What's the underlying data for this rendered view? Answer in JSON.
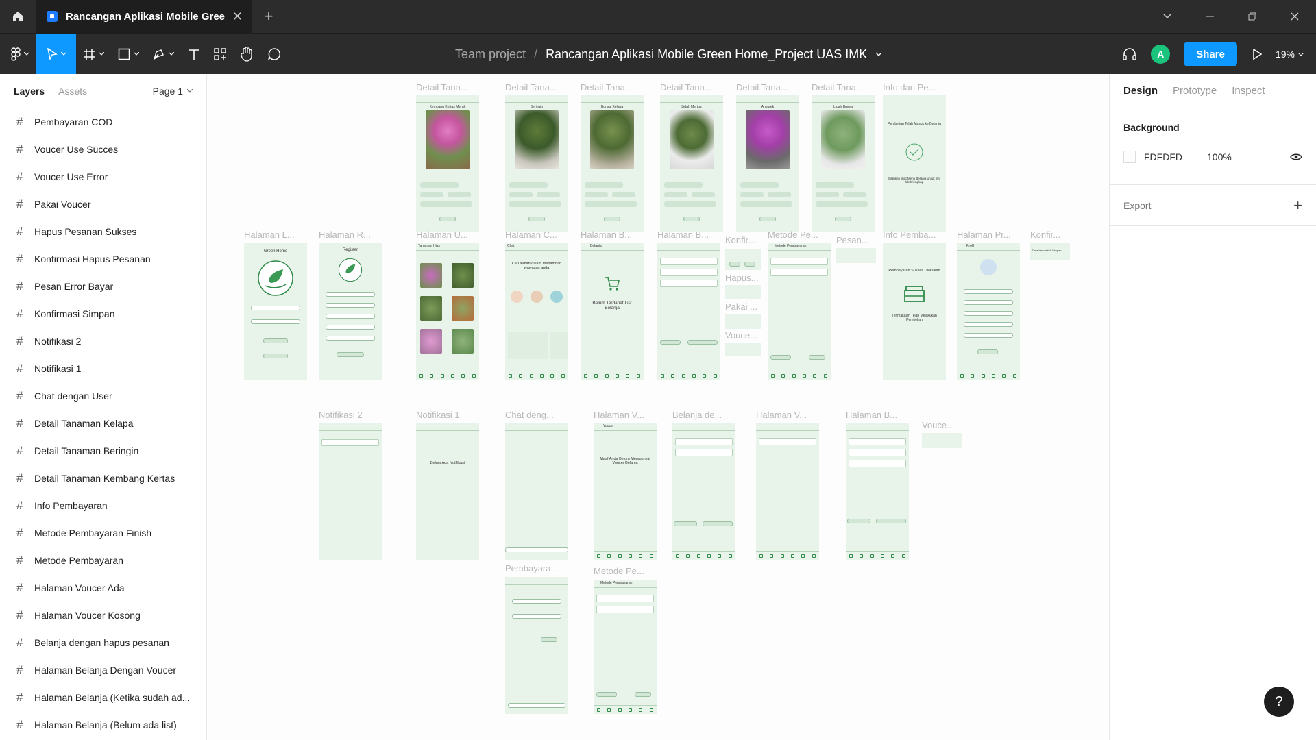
{
  "tab": {
    "title": "Rancangan Aplikasi Mobile Green Home_Project UAS IMK"
  },
  "toolbar": {
    "breadcrumb_team": "Team project",
    "breadcrumb_sep": "/",
    "file_name": "Rancangan Aplikasi Mobile Green Home_Project UAS IMK",
    "avatar_initial": "A",
    "share_label": "Share",
    "zoom": "19%"
  },
  "left_panel": {
    "tab_layers": "Layers",
    "tab_assets": "Assets",
    "page": "Page 1",
    "layers": [
      "Pembayaran COD",
      "Voucer Use Succes",
      "Voucer Use Error",
      "Pakai Voucer",
      "Hapus Pesanan Sukses",
      "Konfirmasi Hapus Pesanan",
      "Pesan Error Bayar",
      "Konfirmasi Simpan",
      "Notifikasi 2",
      "Notifikasi 1",
      "Chat dengan User",
      "Detail Tanaman Kelapa",
      "Detail Tanaman Beringin",
      "Detail Tanaman Kembang Kertas",
      "Info Pembayaran",
      "Metode Pembayaran Finish",
      "Metode Pembayaran",
      "Halaman Voucer Ada",
      "Halaman Voucer Kosong",
      "Belanja dengan hapus pesanan",
      "Halaman Belanja Dengan Voucer",
      "Halaman Belanja (Ketika sudah ad...",
      "Halaman Belanja (Belum ada list)"
    ]
  },
  "canvas": {
    "row1_labels": [
      "Detail Tana...",
      "Detail Tana...",
      "Detail Tana...",
      "Detail Tana...",
      "Detail Tana...",
      "Detail Tana...",
      "Info dari Pe..."
    ],
    "plant_titles": [
      "Kembang Kertas Merah",
      "Beringin",
      "Bonsai Kelapa",
      "Lidah Mertua",
      "Anggrek",
      "Lidah Buaya"
    ],
    "info_text": "Pembelian Telah Masuk ke Belanja",
    "info_sub": "Silahkan lihat Menu Belanja untuk info lebih lengkap",
    "row2_labels": [
      "Halaman L...",
      "Halaman R...",
      "Halaman U...",
      "Halaman C...",
      "Halaman B...",
      "Halaman B...",
      "Konfir...",
      "Metode Pe...",
      "Pesan...",
      "Info Pemba...",
      "Halaman Pr...",
      "Konfir..."
    ],
    "login_title": "Green Home",
    "register_title": "Register",
    "tanaman_hias": "Tanaman Hias",
    "chat_title": "Chat",
    "chat_prompt": "Cari teman dalam menambah wawasan anda",
    "belanja_title": "Belanja",
    "belanja_empty": "Belum Terdapat List Belanja",
    "metode_title": "Metode Pembayaran",
    "pembayaran_sukses": "Pembayaran Sukses Diakukan",
    "terimakasih": "Terimakasih Telah Melakukan Pembelian",
    "profil": "Profil",
    "konfir_text": "Data berhasil di Simpan",
    "hapus_label": "Hapus...",
    "pakai_label": "Pakai ...",
    "vouce_label": "Vouce...",
    "row3_labels": [
      "Notifikasi 2",
      "Notifikasi 1",
      "Chat deng...",
      "Halaman V...",
      "Belanja de...",
      "Halaman V...",
      "Halaman B...",
      "Vouce..."
    ],
    "notif_empty": "Belum Ada Notifikasi",
    "voucer_title": "Voucer",
    "voucer_empty": "Maaf Anda Belum Mempunyai Voucer Belanja",
    "row4_labels": [
      "Pembayara...",
      "Metode Pe..."
    ]
  },
  "right_panel": {
    "tabs": [
      "Design",
      "Prototype",
      "Inspect"
    ],
    "background_title": "Background",
    "bg_hex": "FDFDFD",
    "bg_opacity": "100%",
    "export_label": "Export"
  },
  "help_label": "?"
}
